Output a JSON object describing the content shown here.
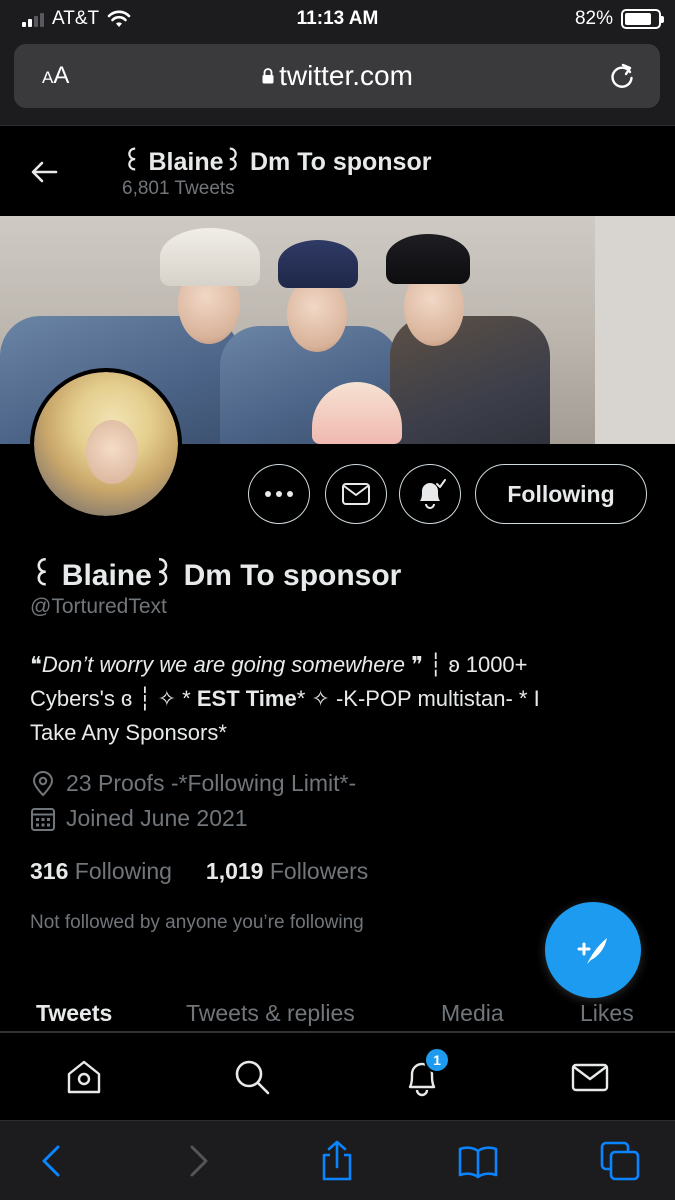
{
  "status_bar": {
    "carrier": "AT&T",
    "time": "11:13 AM",
    "battery": "82%",
    "battery_level": 0.82,
    "signal_bars": 2
  },
  "safari": {
    "text_size_label": "AA",
    "url": "twitter.com"
  },
  "header": {
    "name": "꒰ Blaine꒱ Dm To sponsor",
    "tweet_count": "6,801 Tweets"
  },
  "actions": {
    "following_label": "Following"
  },
  "profile": {
    "name": "꒰ Blaine꒱ Dm To sponsor",
    "handle": "@TorturedText",
    "bio_line1_quote_open": "❝",
    "bio_line1_italic": "Don’t worry we are going somewhere",
    "bio_line1_quote_close": "❞",
    "bio_line1_rest": " ┆ ʚ 1000+",
    "bio_line2_a": "Cybers's ɞ ┆ ✧ * ",
    "bio_line2_bold": "EST Time",
    "bio_line2_b": "* ✧ -K-POP multistan- * I",
    "bio_line3": "Take Any Sponsors*",
    "location": "23 Proofs  -*Following Limit*-",
    "joined": "Joined June 2021",
    "following_count": "316",
    "following_label": "Following",
    "followers_count": "1,019",
    "followers_label": "Followers",
    "not_followed": "Not followed by anyone you’re following"
  },
  "tabs": [
    {
      "label": "Tweets",
      "active": true
    },
    {
      "label": "Tweets & replies",
      "active": false
    },
    {
      "label": "Media",
      "active": false
    },
    {
      "label": "Likes",
      "active": false
    }
  ],
  "nav": {
    "notification_badge": "1"
  },
  "colors": {
    "accent": "#1d9bf0",
    "background": "#000000",
    "muted_text": "#71767b",
    "primary_text": "#e7e9ea",
    "safari_chrome": "#1c1c1e",
    "safari_blue": "#0a84ff"
  },
  "icons": {
    "status": [
      "signal-icon",
      "wifi-icon",
      "battery-icon"
    ],
    "safari_top": [
      "lock-icon",
      "reload-icon"
    ],
    "header": [
      "back-arrow-icon"
    ],
    "actions": [
      "more-icon",
      "mail-icon",
      "bell-check-icon"
    ],
    "meta": [
      "location-pin-icon",
      "calendar-icon"
    ],
    "fab": "compose-tweet-icon",
    "nav": [
      "home-icon",
      "search-icon",
      "bell-icon",
      "mail-icon"
    ],
    "safari_bottom": [
      "chevron-left-icon",
      "chevron-right-icon",
      "share-icon",
      "bookmarks-icon",
      "tabs-icon"
    ]
  }
}
